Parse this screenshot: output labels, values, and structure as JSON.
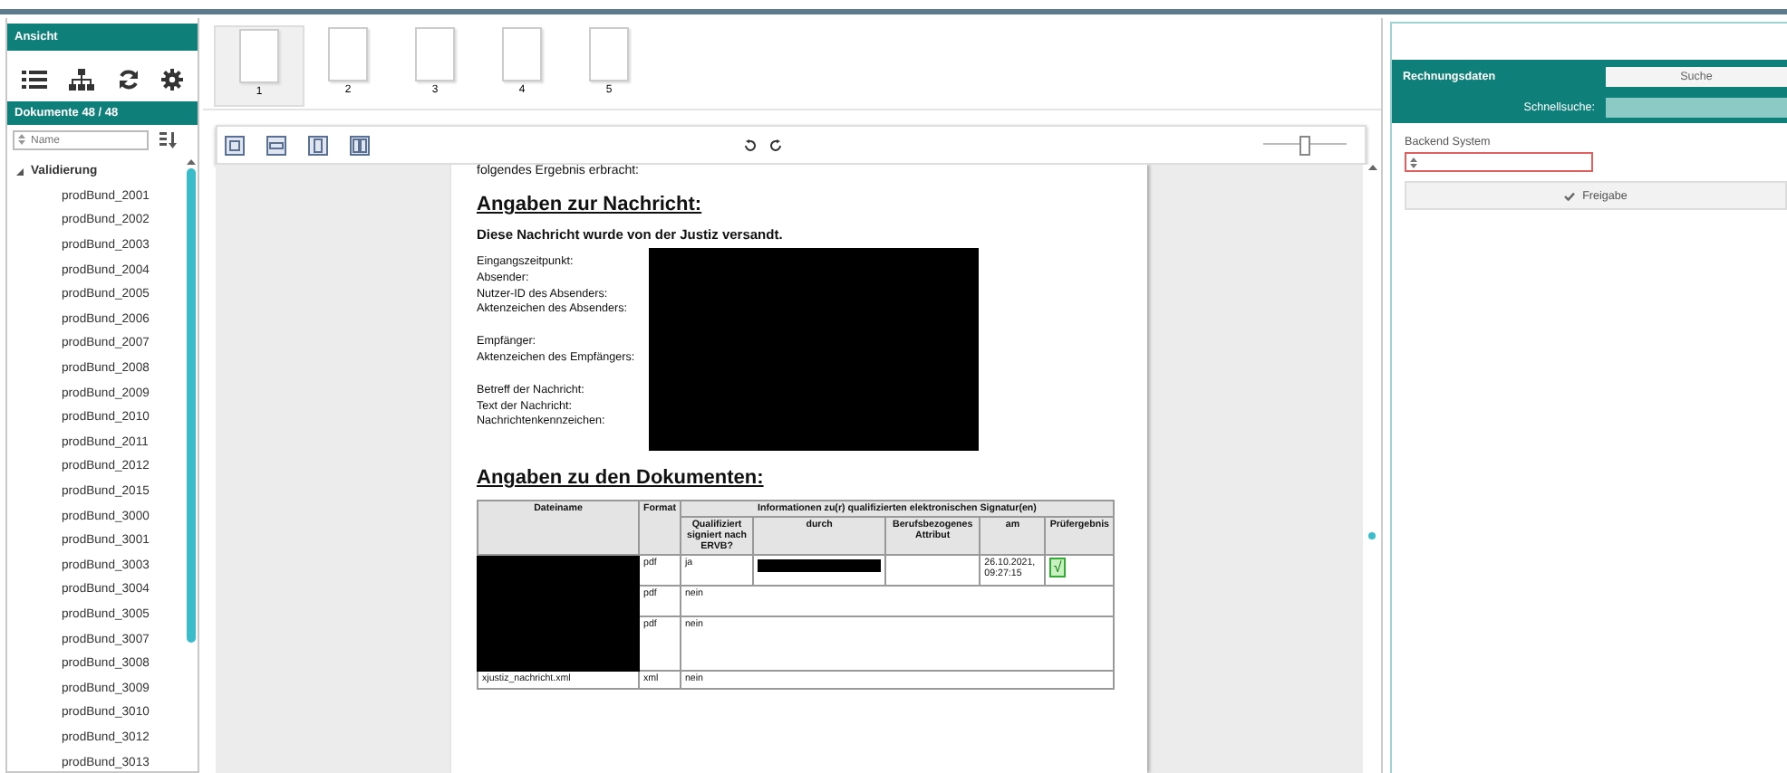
{
  "sidebar": {
    "header": "Ansicht",
    "documents_title": "Dokumente 48 / 48",
    "name_filter": {
      "placeholder": "Name"
    },
    "tree": [
      {
        "label": "Validierung",
        "expanded": true,
        "children": [
          {
            "label": "prodBund_2001"
          },
          {
            "label": "prodBund_2002"
          },
          {
            "label": "prodBund_2003"
          },
          {
            "label": "prodBund_2004"
          },
          {
            "label": "prodBund_2005"
          },
          {
            "label": "prodBund_2006"
          },
          {
            "label": "prodBund_2007"
          },
          {
            "label": "prodBund_2008"
          },
          {
            "label": "prodBund_2009"
          },
          {
            "label": "prodBund_2010"
          },
          {
            "label": "prodBund_2011"
          },
          {
            "label": "prodBund_2012"
          },
          {
            "label": "prodBund_2015"
          },
          {
            "label": "prodBund_3000"
          },
          {
            "label": "prodBund_3001"
          },
          {
            "label": "prodBund_3003"
          },
          {
            "label": "prodBund_3004"
          },
          {
            "label": "prodBund_3005"
          },
          {
            "label": "prodBund_3007"
          },
          {
            "label": "prodBund_3008"
          },
          {
            "label": "prodBund_3009"
          },
          {
            "label": "prodBund_3010"
          },
          {
            "label": "prodBund_3012"
          },
          {
            "label": "prodBund_3013"
          }
        ]
      }
    ]
  },
  "thumbnails": [
    {
      "label": "1",
      "selected": true
    },
    {
      "label": "2",
      "selected": false
    },
    {
      "label": "3",
      "selected": false
    },
    {
      "label": "4",
      "selected": false
    },
    {
      "label": "5",
      "selected": false
    }
  ],
  "viewer_toolbar": {
    "zoom": {
      "level": 0.5
    }
  },
  "document": {
    "intro": "folgendes Ergebnis erbracht:",
    "section_1_title": "Angaben zur Nachricht:",
    "sent_note": "Diese Nachricht wurde von der Justiz versandt.",
    "field_groups": [
      [
        "Eingangszeitpunkt:",
        "Absender:",
        "Nutzer-ID des Absenders:",
        "Aktenzeichen des Absenders:"
      ],
      [
        "Empfänger:",
        "Aktenzeichen des Empfängers:"
      ],
      [
        "Betreff der Nachricht:",
        "Text der Nachricht:",
        "Nachrichtenkennzeichen:"
      ]
    ],
    "values_redacted": true,
    "section_2_title": "Angaben zu den Dokumenten:",
    "table": {
      "columns": [
        "Dateiname",
        "Format"
      ],
      "group_header": "Informationen zu(r) qualifizierten elektronischen Signatur(en)",
      "sub_columns": [
        "Qualifiziert signiert nach ERVB?",
        "durch",
        "Berufsbezogenes Attribut",
        "am",
        "Prüfergebnis"
      ],
      "rows": [
        {
          "filename_redacted": true,
          "format": "pdf",
          "qualified": "ja",
          "by_redacted": true,
          "date": "26.10.2021, 09:27:15",
          "result": "√"
        },
        {
          "filename_redacted": true,
          "format": "pdf",
          "qualified": "nein"
        },
        {
          "filename_redacted": true,
          "format": "pdf",
          "qualified": "nein"
        },
        {
          "filename": "xjustiz_nachricht.xml",
          "format": "xml",
          "qualified": "nein"
        }
      ]
    }
  },
  "right_panel": {
    "title": "Rechnungsdaten",
    "search_button": "Suche",
    "quick_search_label": "Schnellsuche:",
    "backend_system": {
      "label": "Backend System",
      "invalid": true
    },
    "release_button": "Freigabe"
  }
}
